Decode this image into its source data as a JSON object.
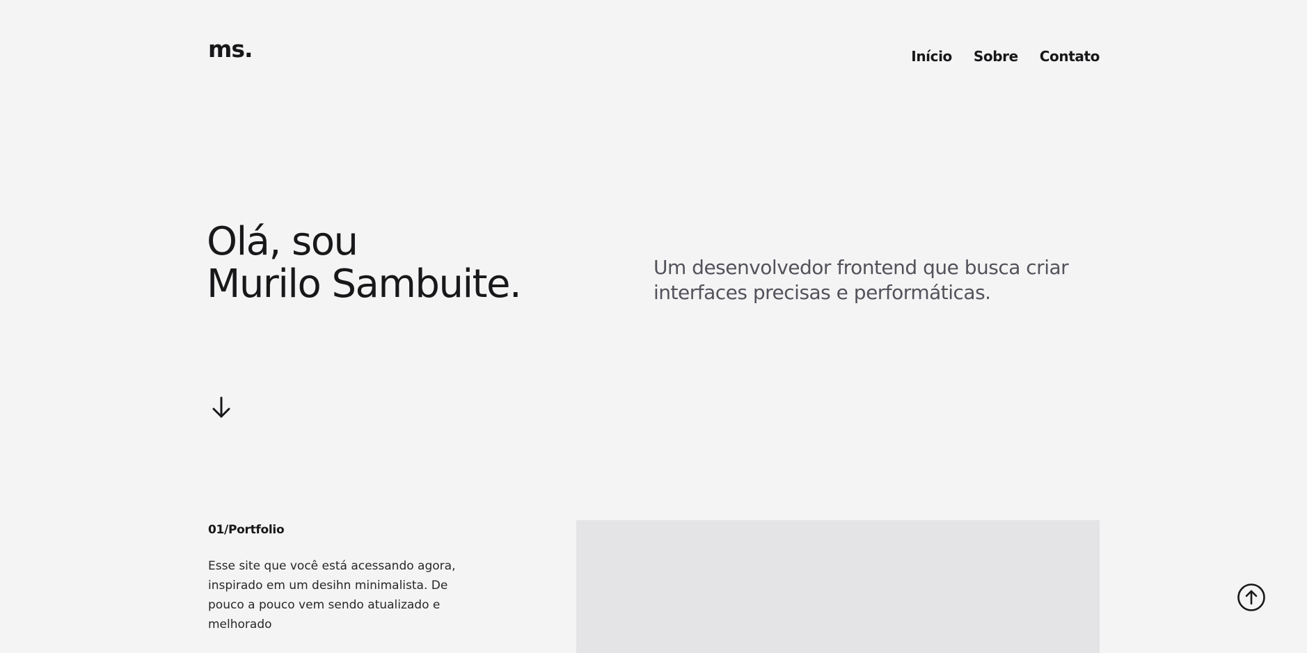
{
  "header": {
    "logo": "ms.",
    "nav": [
      {
        "label": "Início"
      },
      {
        "label": "Sobre"
      },
      {
        "label": "Contato"
      }
    ]
  },
  "hero": {
    "title_line1": "Olá, sou",
    "title_line2": "Murilo Sambuite.",
    "description": "Um desenvolvedor frontend que busca criar interfaces precisas e performáticas.",
    "scroll_icon": "arrow-down-icon"
  },
  "portfolio": {
    "label": "01/Portfolio",
    "text": "Esse site que você está acessando agora, inspirado em um desihn minimalista. De pouco a pouco vem sendo atualizado e melhorado"
  },
  "back_to_top_icon": "arrow-up-circle-icon",
  "colors": {
    "background": "#f4f4f4",
    "text": "#18181b",
    "muted_text": "#52525b",
    "image_placeholder": "#e4e4e7"
  }
}
